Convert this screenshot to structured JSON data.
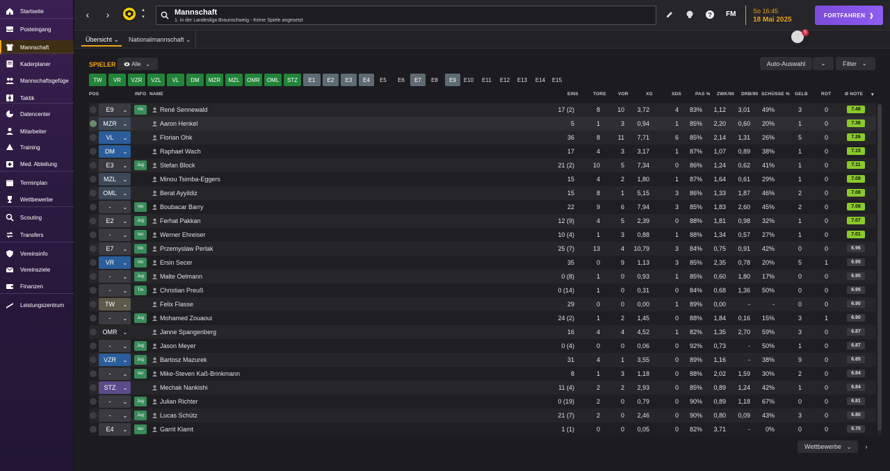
{
  "sidebar": {
    "items": [
      {
        "label": "Startseite",
        "icon": "home-icon"
      },
      {
        "label": "Posteingang",
        "icon": "inbox-icon"
      },
      {
        "label": "Mannschaft",
        "icon": "shirt-icon"
      },
      {
        "label": "Kaderplaner",
        "icon": "planner-icon"
      },
      {
        "label": "Mannschaftsgefüge",
        "icon": "team-dynamics-icon"
      },
      {
        "label": "Taktik",
        "icon": "tactics-icon"
      },
      {
        "label": "Datencenter",
        "icon": "data-icon"
      },
      {
        "label": "Mitarbeiter",
        "icon": "staff-icon"
      },
      {
        "label": "Training",
        "icon": "training-icon"
      },
      {
        "label": "Med. Abteilung",
        "icon": "medical-icon"
      },
      {
        "label": "Terminplan",
        "icon": "calendar-icon"
      },
      {
        "label": "Wettbewerbe",
        "icon": "trophy-icon"
      },
      {
        "label": "Scouting",
        "icon": "scouting-icon"
      },
      {
        "label": "Transfers",
        "icon": "transfers-icon"
      },
      {
        "label": "Vereinsinfo",
        "icon": "shield-icon"
      },
      {
        "label": "Vereinsziele",
        "icon": "goals-icon"
      },
      {
        "label": "Finanzen",
        "icon": "finances-icon"
      },
      {
        "label": "Leistungszentrum",
        "icon": "academy-icon"
      }
    ]
  },
  "header": {
    "title": "Mannschaft",
    "subtitle": "1. in der Landesliga Braunschweig - Keine Spiele angesetzt",
    "fm": "FM",
    "time": "So 16:45",
    "date": "18 Mai 2025",
    "continue": "FORTFAHREN",
    "notifications": "5"
  },
  "tabs": [
    {
      "label": "Übersicht ⌄"
    },
    {
      "label": "Nationalmannschaft ⌄"
    }
  ],
  "toolbar": {
    "heading": "SPIELER",
    "all": "Alle",
    "auto": "Auto-Auswahl",
    "filter": "Filter"
  },
  "chips": [
    "TW",
    "VR",
    "VZR",
    "VZL",
    "VL",
    "DM",
    "MZR",
    "MZL",
    "OMR",
    "OML",
    "STZ",
    "E1",
    "E2",
    "E3",
    "E4",
    "E5",
    "E6",
    "E7",
    "E8",
    "E9",
    "E10",
    "E11",
    "E12",
    "E13",
    "E14",
    "E15"
  ],
  "columns": {
    "pos": "POS",
    "info": "INFO",
    "name": "NAME",
    "eins": "EINS",
    "tore": "TORE",
    "vor": "VOR",
    "xg": "XG",
    "sds": "SDS",
    "pas": "PAS %",
    "zwk": "ZWK/90",
    "drb": "DRB/90",
    "schuesse": "SCHÜSSE %",
    "gelb": "GELB",
    "rot": "ROT",
    "note": "Ø NOTE"
  },
  "players": [
    {
      "pos": "E9",
      "info": "Vin",
      "name": "René Sennewald",
      "eins": "17 (2)",
      "tore": "8",
      "vor": "10",
      "xg": "3,72",
      "sds": "4",
      "pas": "83%",
      "zwk": "1,12",
      "drb": "3,01",
      "sch": "49%",
      "gelb": "3",
      "rot": "0",
      "note": "7.48"
    },
    {
      "pos": "MZR",
      "info": "",
      "name": "Aaron Henkel",
      "eins": "5",
      "tore": "1",
      "vor": "3",
      "xg": "0,94",
      "sds": "1",
      "pas": "85%",
      "zwk": "2,20",
      "drb": "0,60",
      "sch": "20%",
      "gelb": "1",
      "rot": "0",
      "note": "7.36"
    },
    {
      "pos": "VL",
      "info": "",
      "name": "Florian Ohk",
      "eins": "36",
      "tore": "8",
      "vor": "11",
      "xg": "7,71",
      "sds": "6",
      "pas": "85%",
      "zwk": "2,14",
      "drb": "1,31",
      "sch": "26%",
      "gelb": "5",
      "rot": "0",
      "note": "7.26"
    },
    {
      "pos": "DM",
      "info": "",
      "name": "Raphael Wach",
      "eins": "17",
      "tore": "4",
      "vor": "3",
      "xg": "3,17",
      "sds": "1",
      "pas": "87%",
      "zwk": "1,07",
      "drb": "0,89",
      "sch": "38%",
      "gelb": "1",
      "rot": "0",
      "note": "7.15"
    },
    {
      "pos": "E3",
      "info": "Jug",
      "name": "Stefan Block",
      "eins": "21 (2)",
      "tore": "10",
      "vor": "5",
      "xg": "7,34",
      "sds": "0",
      "pas": "86%",
      "zwk": "1,24",
      "drb": "0,62",
      "sch": "41%",
      "gelb": "1",
      "rot": "0",
      "note": "7.11"
    },
    {
      "pos": "MZL",
      "info": "",
      "name": "Minou Tsimba-Eggers",
      "eins": "15",
      "tore": "4",
      "vor": "2",
      "xg": "1,80",
      "sds": "1",
      "pas": "87%",
      "zwk": "1,64",
      "drb": "0,61",
      "sch": "29%",
      "gelb": "1",
      "rot": "0",
      "note": "7.09"
    },
    {
      "pos": "OML",
      "info": "",
      "name": "Berat Ayyildiz",
      "eins": "15",
      "tore": "8",
      "vor": "1",
      "xg": "5,15",
      "sds": "3",
      "pas": "86%",
      "zwk": "1,33",
      "drb": "1,87",
      "sch": "46%",
      "gelb": "2",
      "rot": "0",
      "note": "7.08"
    },
    {
      "pos": "-",
      "info": "Vin",
      "name": "Boubacar Barry",
      "eins": "22",
      "tore": "9",
      "vor": "6",
      "xg": "7,94",
      "sds": "3",
      "pas": "85%",
      "zwk": "1,83",
      "drb": "2,60",
      "sch": "45%",
      "gelb": "2",
      "rot": "0",
      "note": "7.08"
    },
    {
      "pos": "E2",
      "info": "Jug",
      "name": "Ferhat Pakkan",
      "eins": "12 (9)",
      "tore": "4",
      "vor": "5",
      "xg": "2,39",
      "sds": "0",
      "pas": "88%",
      "zwk": "1,81",
      "drb": "0,98",
      "sch": "32%",
      "gelb": "1",
      "rot": "0",
      "note": "7.07"
    },
    {
      "pos": "-",
      "info": "Ver",
      "name": "Werner Ehreiser",
      "eins": "10 (4)",
      "tore": "1",
      "vor": "3",
      "xg": "0,88",
      "sds": "1",
      "pas": "88%",
      "zwk": "1,34",
      "drb": "0,57",
      "sch": "27%",
      "gelb": "1",
      "rot": "0",
      "note": "7.01"
    },
    {
      "pos": "E7",
      "info": "Vin",
      "name": "Przemyslaw Perlak",
      "eins": "25 (7)",
      "tore": "13",
      "vor": "4",
      "xg": "10,79",
      "sds": "3",
      "pas": "84%",
      "zwk": "0,75",
      "drb": "0,91",
      "sch": "42%",
      "gelb": "0",
      "rot": "0",
      "note": "6.96"
    },
    {
      "pos": "VR",
      "info": "Vin",
      "name": "Ersin Secer",
      "eins": "35",
      "tore": "0",
      "vor": "9",
      "xg": "1,13",
      "sds": "3",
      "pas": "85%",
      "zwk": "2,35",
      "drb": "0,78",
      "sch": "20%",
      "gelb": "5",
      "rot": "1",
      "note": "6.95"
    },
    {
      "pos": "-",
      "info": "Jug",
      "name": "Malte Oelmann",
      "eins": "0 (8)",
      "tore": "1",
      "vor": "0",
      "xg": "0,93",
      "sds": "1",
      "pas": "85%",
      "zwk": "0,60",
      "drb": "1,80",
      "sch": "17%",
      "gelb": "0",
      "rot": "0",
      "note": "6.95"
    },
    {
      "pos": "-",
      "info": "Tm",
      "name": "Christian Preuß",
      "eins": "0 (14)",
      "tore": "1",
      "vor": "0",
      "xg": "0,31",
      "sds": "0",
      "pas": "84%",
      "zwk": "0,68",
      "drb": "1,36",
      "sch": "50%",
      "gelb": "0",
      "rot": "0",
      "note": "6.95"
    },
    {
      "pos": "TW",
      "info": "",
      "name": "Felix Flasse",
      "eins": "29",
      "tore": "0",
      "vor": "0",
      "xg": "0,00",
      "sds": "1",
      "pas": "89%",
      "zwk": "0,00",
      "drb": "-",
      "sch": "-",
      "gelb": "0",
      "rot": "0",
      "note": "6.90"
    },
    {
      "pos": "-",
      "info": "Jug",
      "name": "Mohamed Zouaoui",
      "eins": "24 (2)",
      "tore": "1",
      "vor": "2",
      "xg": "1,45",
      "sds": "0",
      "pas": "88%",
      "zwk": "1,84",
      "drb": "0,16",
      "sch": "15%",
      "gelb": "3",
      "rot": "1",
      "note": "6.90"
    },
    {
      "pos": "OMR",
      "info": "",
      "name": "Janne Spangenberg",
      "eins": "16",
      "tore": "4",
      "vor": "4",
      "xg": "4,52",
      "sds": "1",
      "pas": "82%",
      "zwk": "1,35",
      "drb": "2,70",
      "sch": "59%",
      "gelb": "3",
      "rot": "0",
      "note": "6.87"
    },
    {
      "pos": "-",
      "info": "Jug",
      "name": "Jason Meyer",
      "eins": "0 (4)",
      "tore": "0",
      "vor": "0",
      "xg": "0,06",
      "sds": "0",
      "pas": "92%",
      "zwk": "0,73",
      "drb": "-",
      "sch": "50%",
      "gelb": "1",
      "rot": "0",
      "note": "6.87"
    },
    {
      "pos": "VZR",
      "info": "Jug",
      "name": "Bartosz Mazurek",
      "eins": "31",
      "tore": "4",
      "vor": "1",
      "xg": "3,55",
      "sds": "0",
      "pas": "89%",
      "zwk": "1,16",
      "drb": "-",
      "sch": "38%",
      "gelb": "9",
      "rot": "0",
      "note": "6.85"
    },
    {
      "pos": "-",
      "info": "Ver",
      "name": "Mike-Steven Kaß-Brinkmann",
      "eins": "8",
      "tore": "1",
      "vor": "3",
      "xg": "1,18",
      "sds": "0",
      "pas": "88%",
      "zwk": "2,02",
      "drb": "1,59",
      "sch": "30%",
      "gelb": "2",
      "rot": "0",
      "note": "6.84"
    },
    {
      "pos": "STZ",
      "info": "",
      "name": "Mechak Nankishi",
      "eins": "11 (4)",
      "tore": "2",
      "vor": "2",
      "xg": "2,93",
      "sds": "0",
      "pas": "85%",
      "zwk": "0,89",
      "drb": "1,24",
      "sch": "42%",
      "gelb": "1",
      "rot": "0",
      "note": "6.84"
    },
    {
      "pos": "-",
      "info": "Jug",
      "name": "Julian Richter",
      "eins": "0 (19)",
      "tore": "2",
      "vor": "0",
      "xg": "0,79",
      "sds": "0",
      "pas": "90%",
      "zwk": "0,89",
      "drb": "1,18",
      "sch": "67%",
      "gelb": "0",
      "rot": "0",
      "note": "6.81"
    },
    {
      "pos": "-",
      "info": "Jug",
      "name": "Lucas Schütz",
      "eins": "21 (7)",
      "tore": "2",
      "vor": "0",
      "xg": "2,46",
      "sds": "0",
      "pas": "90%",
      "zwk": "0,80",
      "drb": "0,09",
      "sch": "43%",
      "gelb": "3",
      "rot": "0",
      "note": "6.80"
    },
    {
      "pos": "E4",
      "info": "Ver",
      "name": "Garrit Klamt",
      "eins": "1 (1)",
      "tore": "0",
      "vor": "0",
      "xg": "0,05",
      "sds": "0",
      "pas": "82%",
      "zwk": "3,71",
      "drb": "-",
      "sch": "0%",
      "gelb": "0",
      "rot": "0",
      "note": "6.70"
    }
  ],
  "footer": {
    "competitions": "Wettbewerbe"
  }
}
